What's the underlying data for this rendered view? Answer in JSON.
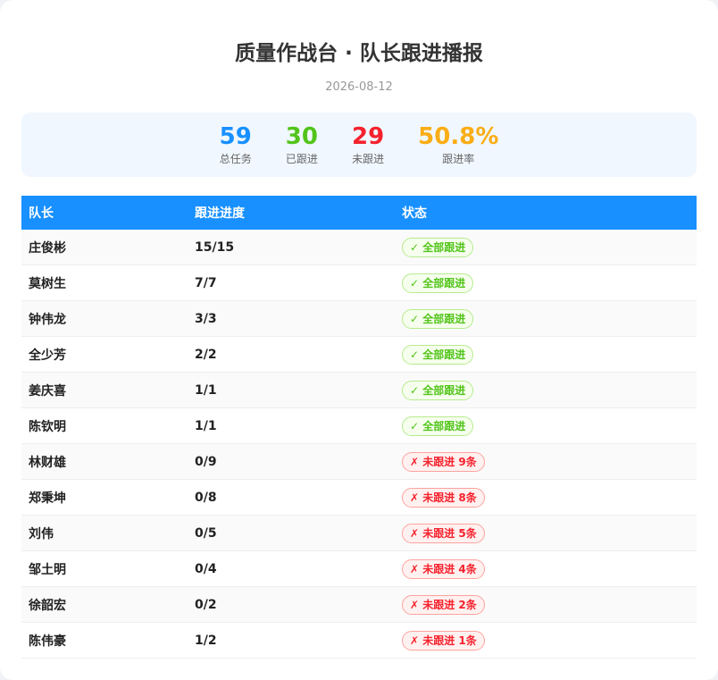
{
  "header": {
    "title": "质量作战台 · 队长跟进播报",
    "date": "2026-08-12"
  },
  "stats": [
    {
      "value": "59",
      "label": "总任务",
      "color": "#1890ff"
    },
    {
      "value": "30",
      "label": "已跟进",
      "color": "#52c41a"
    },
    {
      "value": "29",
      "label": "未跟进",
      "color": "#f5222d"
    },
    {
      "value": "50.8%",
      "label": "跟进率",
      "color": "#faad14"
    }
  ],
  "table": {
    "columns": [
      "队长",
      "跟进进度",
      "状态"
    ],
    "rows": [
      {
        "name": "庄俊彬",
        "progress": "15/15",
        "status": "✓ 全部跟进",
        "ok": true
      },
      {
        "name": "莫树生",
        "progress": "7/7",
        "status": "✓ 全部跟进",
        "ok": true
      },
      {
        "name": "钟伟龙",
        "progress": "3/3",
        "status": "✓ 全部跟进",
        "ok": true
      },
      {
        "name": "全少芳",
        "progress": "2/2",
        "status": "✓ 全部跟进",
        "ok": true
      },
      {
        "name": "姜庆喜",
        "progress": "1/1",
        "status": "✓ 全部跟进",
        "ok": true
      },
      {
        "name": "陈钦明",
        "progress": "1/1",
        "status": "✓ 全部跟进",
        "ok": true
      },
      {
        "name": "林财雄",
        "progress": "0/9",
        "status": "✗ 未跟进 9条",
        "ok": false
      },
      {
        "name": "郑秉坤",
        "progress": "0/8",
        "status": "✗ 未跟进 8条",
        "ok": false
      },
      {
        "name": "刘伟",
        "progress": "0/5",
        "status": "✗ 未跟进 5条",
        "ok": false
      },
      {
        "name": "邹土明",
        "progress": "0/4",
        "status": "✗ 未跟进 4条",
        "ok": false
      },
      {
        "name": "徐韶宏",
        "progress": "0/2",
        "status": "✗ 未跟进 2条",
        "ok": false
      },
      {
        "name": "陈伟豪",
        "progress": "1/2",
        "status": "✗ 未跟进 1条",
        "ok": false
      }
    ]
  }
}
